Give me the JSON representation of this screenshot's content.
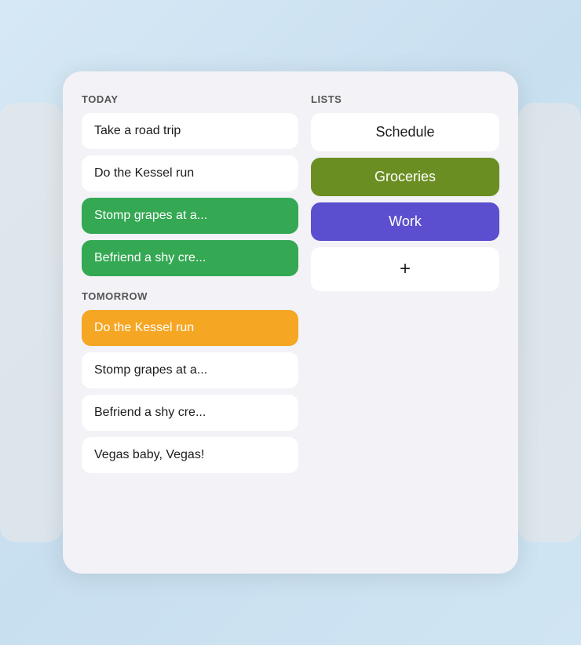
{
  "sections": {
    "today_label": "TODAY",
    "lists_label": "LISTS",
    "tomorrow_label": "TOMORROW"
  },
  "today_tasks": [
    {
      "id": "task-1",
      "text": "Take a road trip",
      "style": "default"
    },
    {
      "id": "task-2",
      "text": "Do the Kessel run",
      "style": "default"
    },
    {
      "id": "task-3",
      "text": "Stomp grapes at a...",
      "style": "green"
    },
    {
      "id": "task-4",
      "text": "Befriend a shy cre...",
      "style": "green"
    }
  ],
  "tomorrow_tasks": [
    {
      "id": "task-5",
      "text": "Do the Kessel run",
      "style": "orange"
    },
    {
      "id": "task-6",
      "text": "Stomp grapes at a...",
      "style": "default"
    },
    {
      "id": "task-7",
      "text": "Befriend a shy cre...",
      "style": "default"
    },
    {
      "id": "task-8",
      "text": "Vegas baby, Vegas!",
      "style": "default"
    }
  ],
  "lists": [
    {
      "id": "list-1",
      "text": "Schedule",
      "style": "default"
    },
    {
      "id": "list-2",
      "text": "Groceries",
      "style": "olive"
    },
    {
      "id": "list-3",
      "text": "Work",
      "style": "purple"
    },
    {
      "id": "list-add",
      "text": "+",
      "style": "add"
    }
  ]
}
